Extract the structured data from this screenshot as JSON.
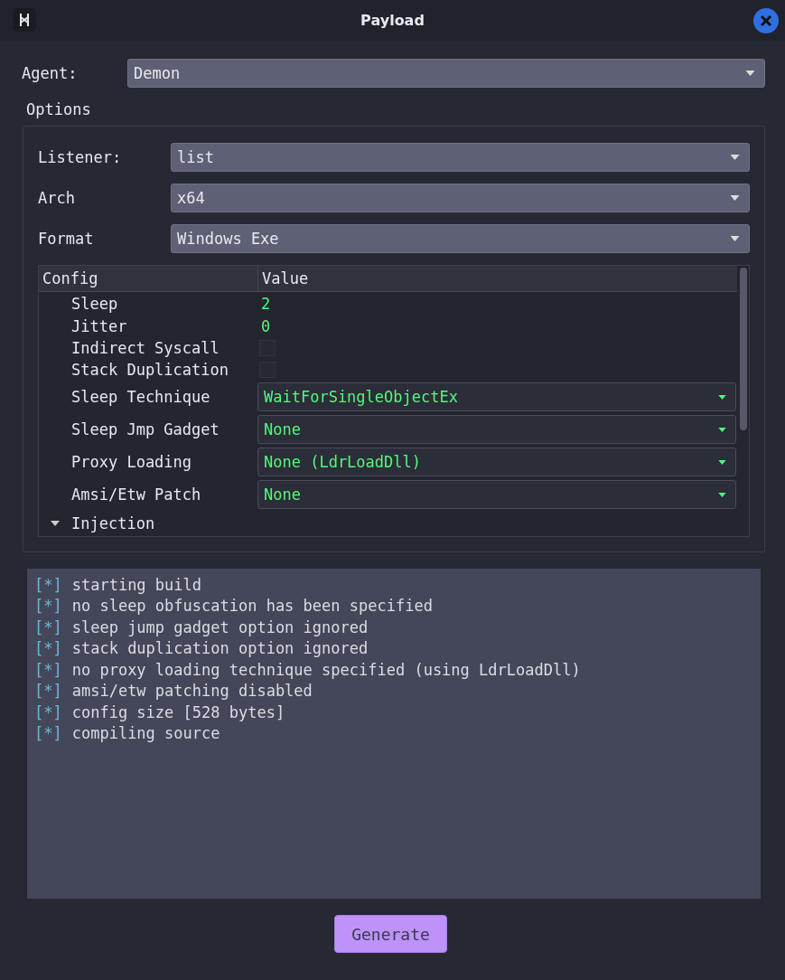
{
  "window": {
    "title": "Payload"
  },
  "agent": {
    "label": "Agent:",
    "value": "Demon"
  },
  "options": {
    "title": "Options",
    "fields": [
      {
        "label": "Listener:",
        "value": "list"
      },
      {
        "label": "Arch",
        "value": "x64"
      },
      {
        "label": "Format",
        "value": "Windows Exe"
      }
    ],
    "table": {
      "columns": [
        "Config",
        "Value"
      ],
      "rows": [
        {
          "kind": "number",
          "name": "Sleep",
          "value": "2"
        },
        {
          "kind": "number",
          "name": "Jitter",
          "value": "0"
        },
        {
          "kind": "checkbox",
          "name": "Indirect Syscall",
          "checked": false
        },
        {
          "kind": "checkbox",
          "name": "Stack Duplication",
          "checked": false
        },
        {
          "kind": "combo",
          "name": "Sleep Technique",
          "value": "WaitForSingleObjectEx"
        },
        {
          "kind": "combo",
          "name": "Sleep Jmp Gadget",
          "value": "None"
        },
        {
          "kind": "combo",
          "name": "Proxy Loading",
          "value": "None (LdrLoadDll)"
        },
        {
          "kind": "combo",
          "name": "Amsi/Etw Patch",
          "value": "None"
        },
        {
          "kind": "group",
          "name": "Injection",
          "expanded": true
        }
      ]
    }
  },
  "log": [
    {
      "marker": "[*]",
      "text": "starting build"
    },
    {
      "marker": "[*]",
      "text": "no sleep obfuscation has been specified"
    },
    {
      "marker": "[*]",
      "text": "sleep jump gadget option ignored"
    },
    {
      "marker": "[*]",
      "text": "stack duplication option ignored"
    },
    {
      "marker": "[*]",
      "text": "no proxy loading technique specified (using LdrLoadDll)"
    },
    {
      "marker": "[*]",
      "text": "amsi/etw patching disabled"
    },
    {
      "marker": "[*]",
      "text": "config size [528 bytes]"
    },
    {
      "marker": "[*]",
      "text": "compiling source"
    }
  ],
  "buttons": [
    "Generate"
  ]
}
